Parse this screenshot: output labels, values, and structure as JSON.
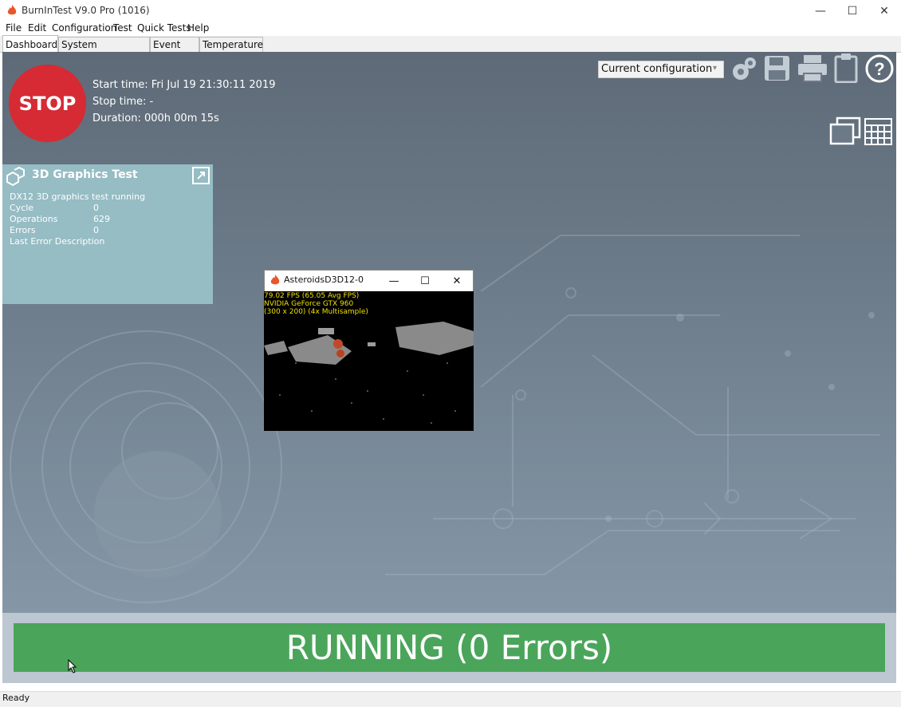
{
  "window": {
    "title": "BurnInTest V9.0 Pro (1016)",
    "minimize": "—",
    "maximize": "☐",
    "close": "✕"
  },
  "menu": [
    "File",
    "Edit",
    "Configuration",
    "Test",
    "Quick Tests",
    "Help"
  ],
  "tabs": [
    "Dashboard",
    "System Information",
    "Event Log",
    "Temperature"
  ],
  "stop_label": "STOP",
  "times": {
    "start": "Start time: Fri Jul 19 21:30:11 2019",
    "stop": "Stop time: -",
    "duration": "Duration: 000h 00m 15s"
  },
  "config_select": "Current configuration",
  "panel": {
    "title": "3D Graphics Test",
    "status": "DX12 3D graphics test running",
    "rows": [
      {
        "label": "Cycle",
        "value": "0"
      },
      {
        "label": "Operations",
        "value": "629"
      },
      {
        "label": "Errors",
        "value": "0"
      },
      {
        "label": "Last Error Description",
        "value": ""
      }
    ]
  },
  "asteroids": {
    "title": "AsteroidsD3D12-0",
    "fps": "79.02 FPS (65.05 Avg FPS)",
    "gpu": "NVIDIA GeForce GTX 960",
    "mode": "(300 x 200) (4x Multisample)",
    "minimize": "—",
    "maximize": "☐",
    "close": "✕"
  },
  "running_text": "RUNNING (0 Errors)",
  "status": "Ready",
  "colors": {
    "stop": "#d62a35",
    "running": "#4aa55a",
    "panel": "#96bcc4"
  }
}
